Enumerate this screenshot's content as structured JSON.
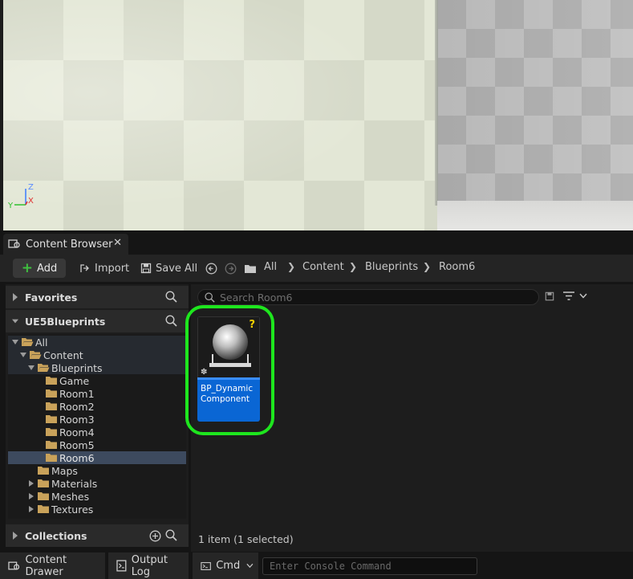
{
  "viewport": {
    "axis": {
      "z_label": "Z",
      "y_label": "Y",
      "x_label": "X"
    }
  },
  "tab": {
    "label": "Content Browser",
    "close": "✕"
  },
  "toolbar": {
    "add_label": "Add",
    "import_label": "Import",
    "save_all_label": "Save All",
    "breadcrumb": [
      "All",
      "Content",
      "Blueprints",
      "Room6"
    ]
  },
  "sidebar": {
    "favorites_label": "Favorites",
    "project_label": "UE5Blueprints",
    "collections_label": "Collections",
    "tree": [
      {
        "label": "All",
        "depth": 0
      },
      {
        "label": "Content",
        "depth": 1
      },
      {
        "label": "Blueprints",
        "depth": 2
      },
      {
        "label": "Game",
        "depth": 3
      },
      {
        "label": "Room1",
        "depth": 3
      },
      {
        "label": "Room2",
        "depth": 3
      },
      {
        "label": "Room3",
        "depth": 3
      },
      {
        "label": "Room4",
        "depth": 3
      },
      {
        "label": "Room5",
        "depth": 3
      },
      {
        "label": "Room6",
        "depth": 3,
        "selected": true
      },
      {
        "label": "Maps",
        "depth": 2
      },
      {
        "label": "Materials",
        "depth": 2
      },
      {
        "label": "Meshes",
        "depth": 2
      },
      {
        "label": "Textures",
        "depth": 2
      }
    ]
  },
  "assets": {
    "search_placeholder": "Search Room6",
    "items": [
      {
        "name": "BP_Dynamic Component",
        "badge": "?"
      }
    ],
    "status": "1 item (1 selected)"
  },
  "bottombar": {
    "content_drawer_label": "Content Drawer",
    "output_log_label": "Output Log",
    "cmd_label": "Cmd",
    "console_placeholder": "Enter Console Command"
  },
  "colors": {
    "accent_selected": "#0a66d4",
    "highlight_ring": "#1ee61e",
    "add_plus": "#3fbf3f",
    "folder": "#c9a25a"
  }
}
